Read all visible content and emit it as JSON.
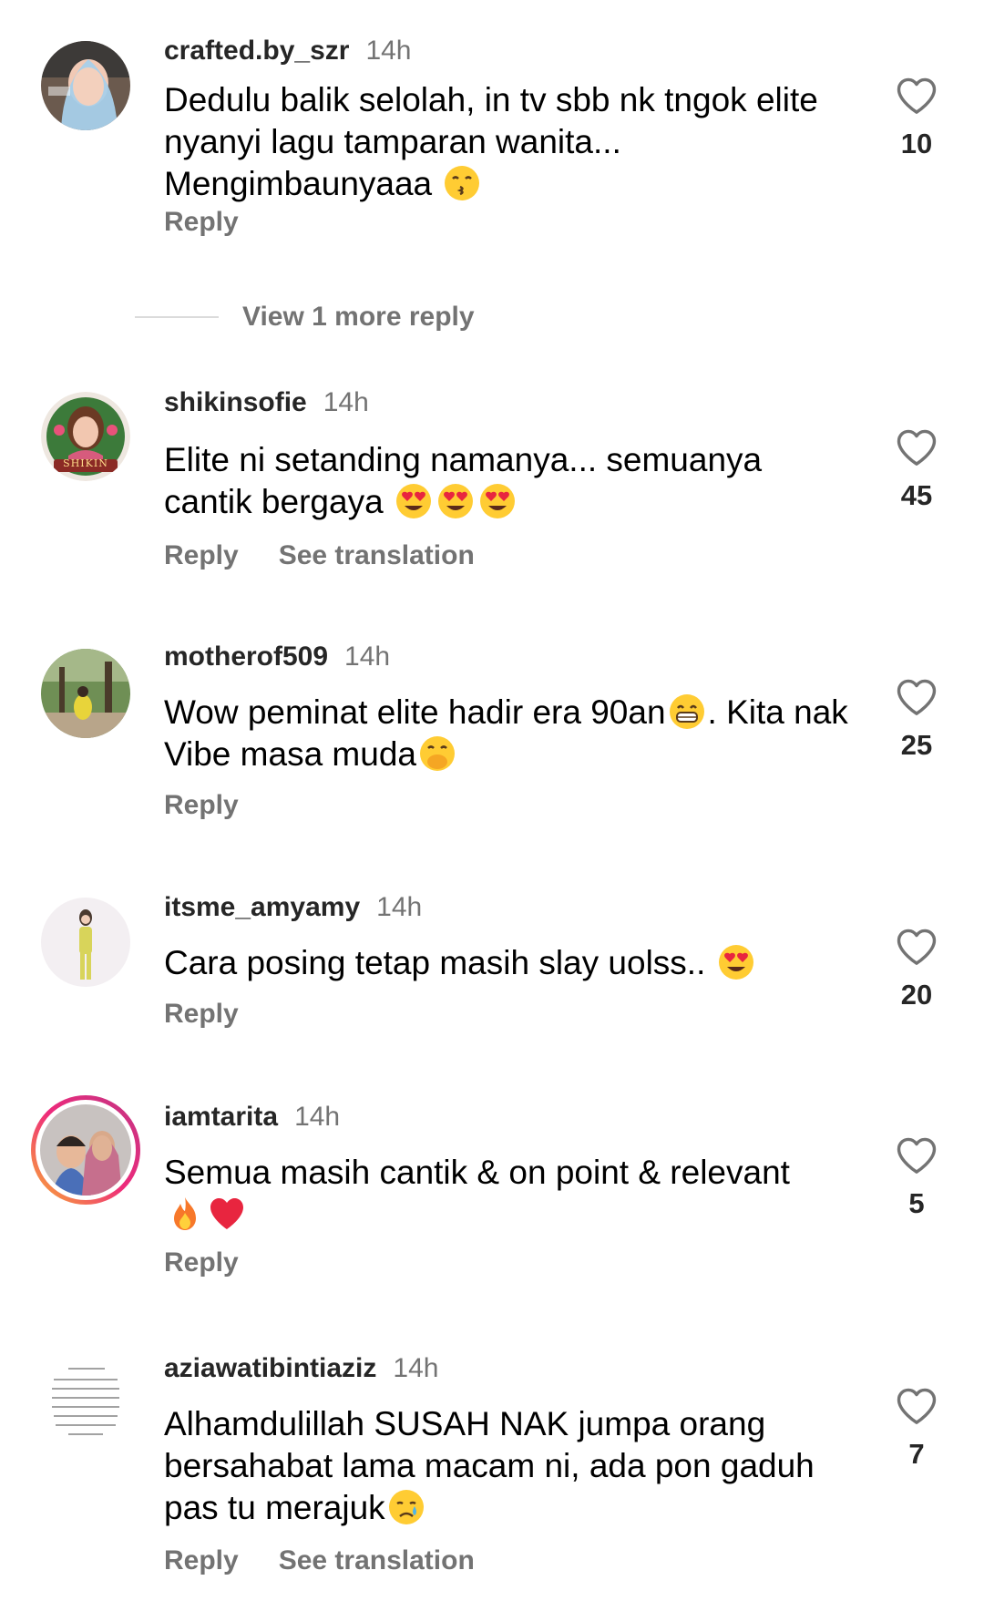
{
  "comments": [
    {
      "username": "crafted.by_szr",
      "time": "14h",
      "text": "Dedulu balik selolah, in tv sbb nk tngok elite nyanyi lagu tamparan wanita... Mengimbaunyaaa",
      "emojis": [
        "kissing-face"
      ],
      "likes": "10",
      "reply_label": "Reply",
      "view_more_label": "View 1 more reply"
    },
    {
      "username": "shikinsofie",
      "time": "14h",
      "text": "Elite ni  setanding namanya... semuanya cantik bergaya",
      "emojis": [
        "heart-eyes",
        "heart-eyes",
        "heart-eyes"
      ],
      "likes": "45",
      "reply_label": "Reply",
      "translate_label": "See translation",
      "avatar_badge": "SHIKIN"
    },
    {
      "username": "motherof509",
      "time": "14h",
      "text_a": "Wow peminat elite hadir era 90an",
      "text_b": ". Kita nak Vibe masa muda",
      "emojis": [
        "grinning-face",
        "hand-over-mouth"
      ],
      "likes": "25",
      "reply_label": "Reply"
    },
    {
      "username": "itsme_amyamy",
      "time": "14h",
      "text": "Cara posing tetap masih slay uolss..",
      "emojis": [
        "heart-eyes"
      ],
      "likes": "20",
      "reply_label": "Reply"
    },
    {
      "username": "iamtarita",
      "time": "14h",
      "text": "Semua masih cantik & on point & relevant",
      "emojis": [
        "fire",
        "red-heart"
      ],
      "likes": "5",
      "reply_label": "Reply"
    },
    {
      "username": "aziawatibintiaziz",
      "time": "14h",
      "text": "Alhamdulillah SUSAH NAK jumpa orang bersahabat lama macam ni, ada pon gaduh pas tu merajuk",
      "emojis": [
        "crying-face"
      ],
      "likes": "7",
      "reply_label": "Reply",
      "translate_label": "See translation"
    }
  ],
  "colors": {
    "username": "#262626",
    "secondary": "#737373",
    "divider": "#dbdbdb",
    "story_ring": [
      "#f9b233",
      "#ee2a7b",
      "#c13584"
    ]
  }
}
